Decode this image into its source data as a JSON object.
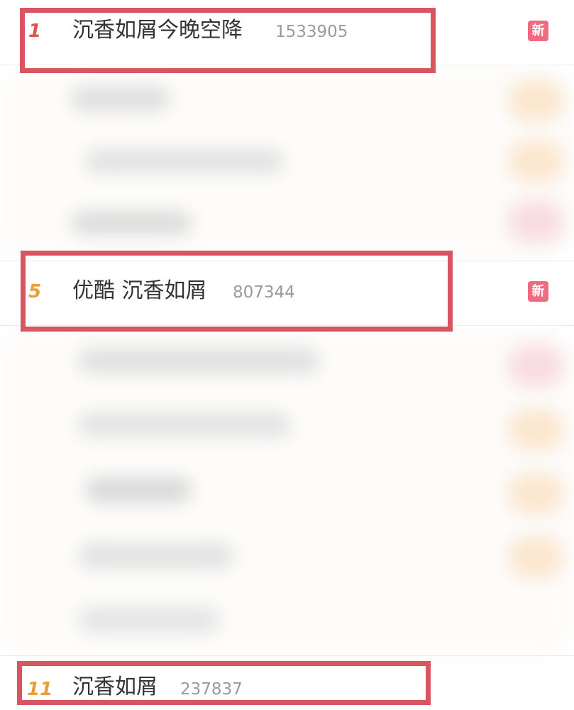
{
  "hot_list": {
    "items": [
      {
        "rank": "1",
        "title": "沉香如屑今晚空降",
        "count": "1533905",
        "badge": "新",
        "rank_color": "#e1544e"
      },
      {
        "rank": "5",
        "title": "优酷 沉香如屑",
        "count": "807344",
        "badge": "新",
        "rank_color": "#e5a03b"
      },
      {
        "rank": "11",
        "title": "沉香如屑",
        "count": "237837",
        "badge": "",
        "rank_color": "#e5a03b"
      }
    ]
  },
  "colors": {
    "highlight_border": "#d9555f",
    "badge_new_bg": "#f06a80",
    "text_primary": "#333333",
    "text_secondary": "#9a9a9a"
  }
}
